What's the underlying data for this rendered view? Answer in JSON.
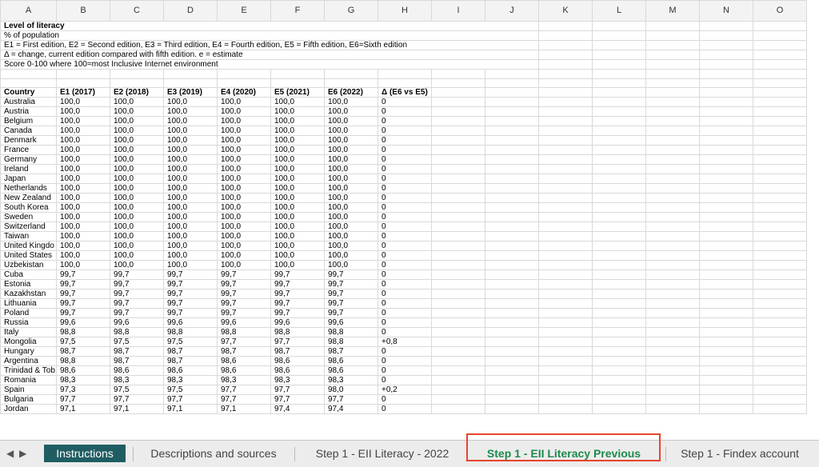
{
  "columns": [
    "A",
    "B",
    "C",
    "D",
    "E",
    "F",
    "G",
    "H",
    "I",
    "J",
    "K",
    "L",
    "M",
    "N",
    "O"
  ],
  "header_notes": [
    "Level of literacy",
    "% of population",
    "E1 = First edition, E2 = Second edition, E3 = Third edition, E4 = Fourth edition, E5 = Fifth edition, E6=Sixth edition",
    "Δ = change, current edition compared with fifth edition. e = estimate",
    "Score 0-100 where 100=most Inclusive Internet environment"
  ],
  "table_header": [
    "Country",
    "E1 (2017)",
    "E2 (2018)",
    "E3 (2019)",
    "E4 (2020)",
    "E5 (2021)",
    "E6 (2022)",
    "Δ (E6 vs E5)"
  ],
  "rows": [
    [
      "Australia",
      "100,0",
      "100,0",
      "100,0",
      "100,0",
      "100,0",
      "100,0",
      "0"
    ],
    [
      "Austria",
      "100,0",
      "100,0",
      "100,0",
      "100,0",
      "100,0",
      "100,0",
      "0"
    ],
    [
      "Belgium",
      "100,0",
      "100,0",
      "100,0",
      "100,0",
      "100,0",
      "100,0",
      "0"
    ],
    [
      "Canada",
      "100,0",
      "100,0",
      "100,0",
      "100,0",
      "100,0",
      "100,0",
      "0"
    ],
    [
      "Denmark",
      "100,0",
      "100,0",
      "100,0",
      "100,0",
      "100,0",
      "100,0",
      "0"
    ],
    [
      "France",
      "100,0",
      "100,0",
      "100,0",
      "100,0",
      "100,0",
      "100,0",
      "0"
    ],
    [
      "Germany",
      "100,0",
      "100,0",
      "100,0",
      "100,0",
      "100,0",
      "100,0",
      "0"
    ],
    [
      "Ireland",
      "100,0",
      "100,0",
      "100,0",
      "100,0",
      "100,0",
      "100,0",
      "0"
    ],
    [
      "Japan",
      "100,0",
      "100,0",
      "100,0",
      "100,0",
      "100,0",
      "100,0",
      "0"
    ],
    [
      "Netherlands",
      "100,0",
      "100,0",
      "100,0",
      "100,0",
      "100,0",
      "100,0",
      "0"
    ],
    [
      "New Zealand",
      "100,0",
      "100,0",
      "100,0",
      "100,0",
      "100,0",
      "100,0",
      "0"
    ],
    [
      "South Korea",
      "100,0",
      "100,0",
      "100,0",
      "100,0",
      "100,0",
      "100,0",
      "0"
    ],
    [
      "Sweden",
      "100,0",
      "100,0",
      "100,0",
      "100,0",
      "100,0",
      "100,0",
      "0"
    ],
    [
      "Switzerland",
      "100,0",
      "100,0",
      "100,0",
      "100,0",
      "100,0",
      "100,0",
      "0"
    ],
    [
      "Taiwan",
      "100,0",
      "100,0",
      "100,0",
      "100,0",
      "100,0",
      "100,0",
      "0"
    ],
    [
      "United Kingdo",
      "100,0",
      "100,0",
      "100,0",
      "100,0",
      "100,0",
      "100,0",
      "0"
    ],
    [
      "United States",
      "100,0",
      "100,0",
      "100,0",
      "100,0",
      "100,0",
      "100,0",
      "0"
    ],
    [
      "Uzbekistan",
      "100,0",
      "100,0",
      "100,0",
      "100,0",
      "100,0",
      "100,0",
      "0"
    ],
    [
      "Cuba",
      "99,7",
      "99,7",
      "99,7",
      "99,7",
      "99,7",
      "99,7",
      "0"
    ],
    [
      "Estonia",
      "99,7",
      "99,7",
      "99,7",
      "99,7",
      "99,7",
      "99,7",
      "0"
    ],
    [
      "Kazakhstan",
      "99,7",
      "99,7",
      "99,7",
      "99,7",
      "99,7",
      "99,7",
      "0"
    ],
    [
      "Lithuania",
      "99,7",
      "99,7",
      "99,7",
      "99,7",
      "99,7",
      "99,7",
      "0"
    ],
    [
      "Poland",
      "99,7",
      "99,7",
      "99,7",
      "99,7",
      "99,7",
      "99,7",
      "0"
    ],
    [
      "Russia",
      "99,6",
      "99,6",
      "99,6",
      "99,6",
      "99,6",
      "99,6",
      "0"
    ],
    [
      "Italy",
      "98,8",
      "98,8",
      "98,8",
      "98,8",
      "98,8",
      "98,8",
      "0"
    ],
    [
      "Mongolia",
      "97,5",
      "97,5",
      "97,5",
      "97,7",
      "97,7",
      "98,8",
      "+0,8"
    ],
    [
      "Hungary",
      "98,7",
      "98,7",
      "98,7",
      "98,7",
      "98,7",
      "98,7",
      "0"
    ],
    [
      "Argentina",
      "98,8",
      "98,7",
      "98,7",
      "98,6",
      "98,6",
      "98,6",
      "0"
    ],
    [
      "Trinidad & Tob",
      "98,6",
      "98,6",
      "98,6",
      "98,6",
      "98,6",
      "98,6",
      "0"
    ],
    [
      "Romania",
      "98,3",
      "98,3",
      "98,3",
      "98,3",
      "98,3",
      "98,3",
      "0"
    ],
    [
      "Spain",
      "97,3",
      "97,5",
      "97,5",
      "97,7",
      "97,7",
      "98,0",
      "+0,2"
    ],
    [
      "Bulgaria",
      "97,7",
      "97,7",
      "97,7",
      "97,7",
      "97,7",
      "97,7",
      "0"
    ],
    [
      "Jordan",
      "97,1",
      "97,1",
      "97,1",
      "97,1",
      "97,4",
      "97,4",
      "0"
    ]
  ],
  "tabs": [
    "Instructions",
    "Descriptions and sources",
    "Step 1 - EII Literacy - 2022",
    "Step 1 - EII Literacy Previous",
    "Step 1 - Findex account"
  ],
  "colors": {
    "active_tab_bg": "#1f5d63",
    "highlight_tab_text": "#1e8a4c",
    "annotation_box": "#e8442d",
    "delta_text": "#7b2a8c"
  },
  "icons": {
    "prev": "triangle-left-icon",
    "next": "triangle-right-icon"
  }
}
